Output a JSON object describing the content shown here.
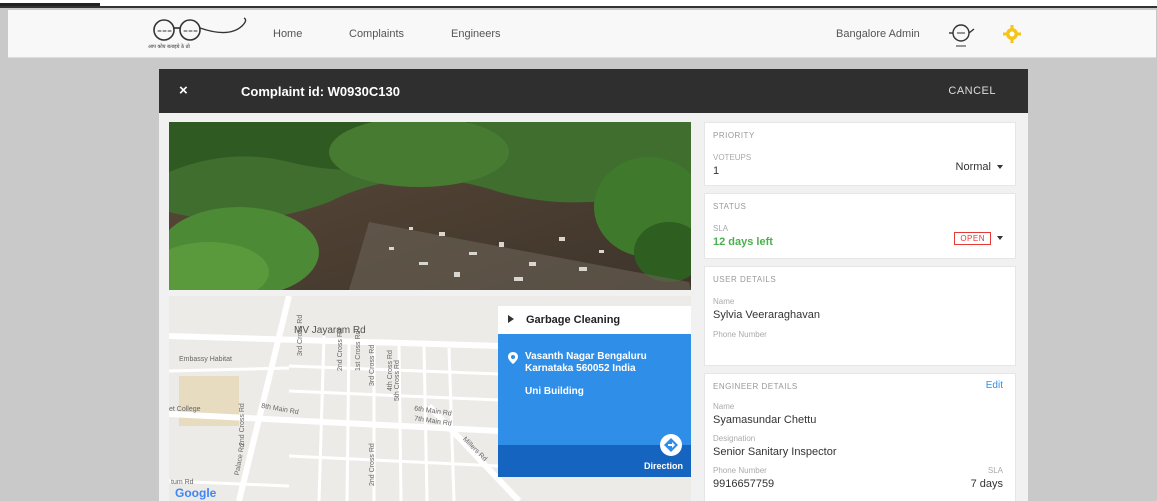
{
  "nav": {
    "links": [
      "Home",
      "Complaints",
      "Engineers"
    ],
    "admin": "Bangalore Admin",
    "logo_text": "आप कोय बताइये ठे ठो"
  },
  "modal": {
    "close": "×",
    "title": "Complaint id: W0930C130",
    "cancel": "CANCEL"
  },
  "map": {
    "roads": [
      "MV Jayaram Rd",
      "Embassy Habitat",
      "et College",
      "8th Main Rd",
      "6th Main Rd",
      "7th Main Rd",
      "Millers Rd",
      "Palace Rd",
      "3rd Cross Rd",
      "2nd Cross Rd",
      "1st Cross Rd",
      "3rd Cross Rd",
      "4th Cross Rd",
      "5th Cross Rd",
      "2nd Cross Rd",
      "2nd Cross Rd",
      "tum Rd"
    ],
    "google": "Google",
    "info": {
      "category": "Garbage Cleaning",
      "address": "Vasanth Nagar Bengaluru Karnataka 560052 India",
      "building": "Uni Building",
      "direction": "Direction"
    }
  },
  "priority": {
    "heading": "PRIORITY",
    "voteups_label": "VOTEUPS",
    "voteups": "1",
    "level": "Normal"
  },
  "status": {
    "heading": "STATUS",
    "sla_label": "SLA",
    "sla": "12 days left",
    "state": "OPEN"
  },
  "user": {
    "heading": "USER DETAILS",
    "name_label": "Name",
    "name": "Sylvia Veeraraghavan",
    "phone_label": "Phone Number"
  },
  "engineer": {
    "heading": "ENGINEER DETAILS",
    "edit": "Edit",
    "name_label": "Name",
    "name": "Syamasundar Chettu",
    "designation_label": "Designation",
    "designation": "Senior Sanitary Inspector",
    "phone_label": "Phone Number",
    "phone": "9916657759",
    "sla_label": "SLA",
    "sla": "7 days"
  },
  "colors": {
    "accent": "#2f8fe8",
    "header": "#2f2f2f",
    "ok": "#4caf50",
    "danger": "#e53935",
    "gear": "#f5c518"
  }
}
